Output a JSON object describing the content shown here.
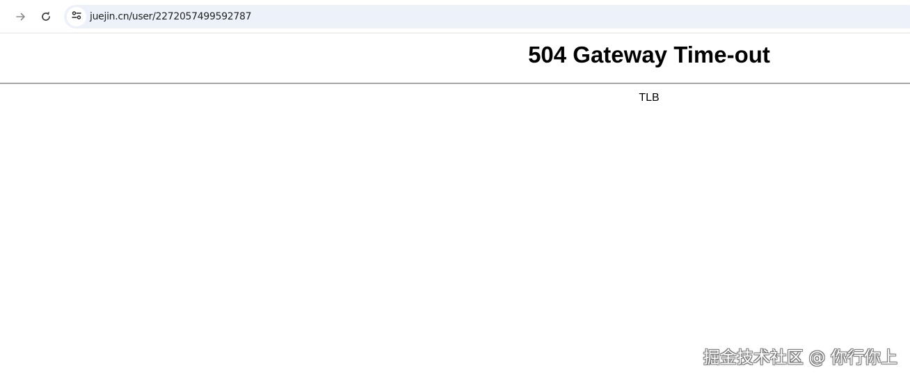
{
  "browser": {
    "url": "juejin.cn/user/2272057499592787",
    "icons": {
      "forward": "arrow-right-icon",
      "reload": "reload-icon",
      "site_info": "tune-icon"
    },
    "omnibox_color": "#edf2fa"
  },
  "page": {
    "title": "504 Gateway Time-out",
    "server": "TLB"
  },
  "watermark": {
    "text": "掘金技术社区 @ 你行你上"
  }
}
